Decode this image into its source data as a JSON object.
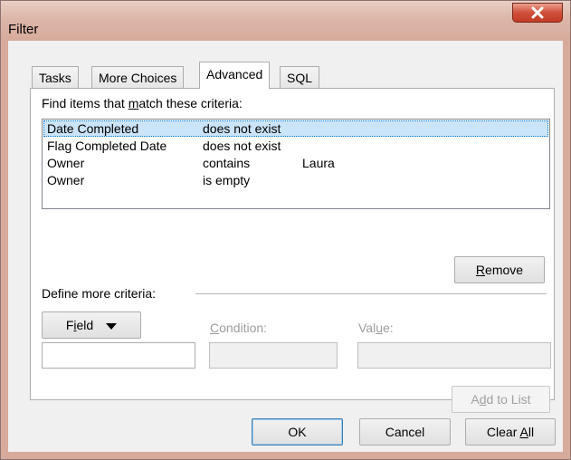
{
  "window": {
    "title": "Filter",
    "close_label": "X"
  },
  "tabs": [
    {
      "label": "Tasks",
      "active": false
    },
    {
      "label": "More Choices",
      "active": false
    },
    {
      "label": "Advanced",
      "active": true
    },
    {
      "label": "SQL",
      "active": false
    }
  ],
  "criteria": {
    "heading_pre": "Find items that ",
    "heading_key": "m",
    "heading_post": "atch these criteria:",
    "rows": [
      {
        "field": "Date Completed",
        "condition": "does not exist",
        "value": "",
        "selected": true
      },
      {
        "field": "Flag Completed Date",
        "condition": "does not exist",
        "value": "",
        "selected": false
      },
      {
        "field": "Owner",
        "condition": "contains",
        "value": "Laura",
        "selected": false
      },
      {
        "field": "Owner",
        "condition": "is empty",
        "value": "",
        "selected": false
      }
    ],
    "remove_key": "R",
    "remove_rest": "emove"
  },
  "define": {
    "heading": "Define more criteria:",
    "field_pre": "F",
    "field_key": "i",
    "field_post": "eld",
    "condition_key": "C",
    "condition_rest": "ondition:",
    "value_pre": "Val",
    "value_key": "u",
    "value_post": "e:",
    "field_value": "",
    "condition_value": "",
    "value_value": "",
    "add_pre": "A",
    "add_key": "d",
    "add_post": "d to List"
  },
  "footer": {
    "ok": "OK",
    "cancel": "Cancel",
    "clear_pre": "Clear ",
    "clear_key": "A",
    "clear_post": "ll"
  },
  "colors": {
    "titlebar": "#d7ab9c",
    "close": "#c23a24",
    "selection": "#cce4f7"
  }
}
